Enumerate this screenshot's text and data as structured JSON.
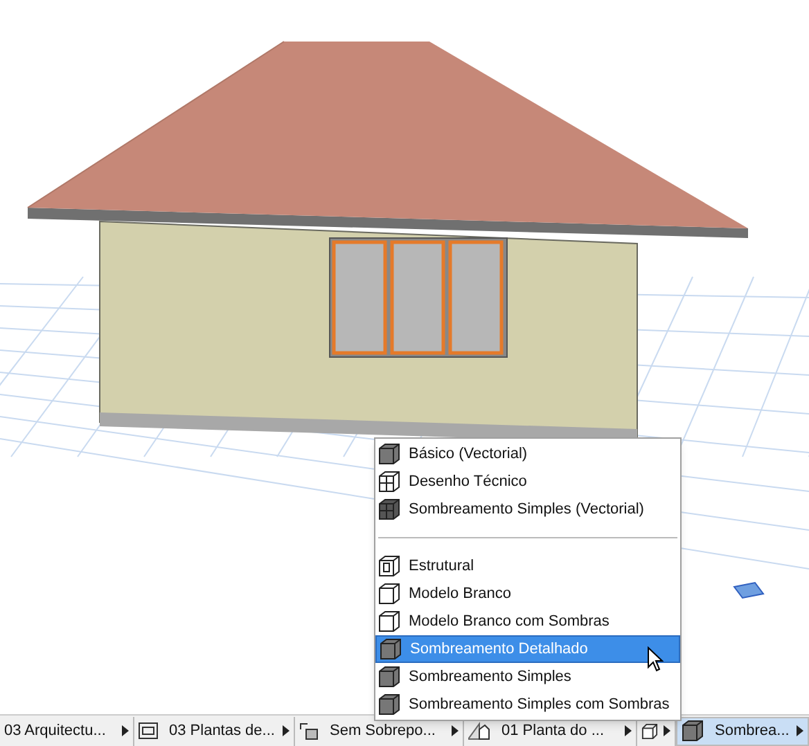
{
  "menu": {
    "groups": [
      [
        {
          "label": "Básico (Vectorial)",
          "selected": false
        },
        {
          "label": "Desenho Técnico",
          "selected": false
        },
        {
          "label": "Sombreamento Simples (Vectorial)",
          "selected": false
        }
      ],
      [
        {
          "label": "Estrutural",
          "selected": false
        },
        {
          "label": "Modelo Branco",
          "selected": false
        },
        {
          "label": "Modelo Branco com Sombras",
          "selected": false
        },
        {
          "label": "Sombreamento Detalhado",
          "selected": true
        },
        {
          "label": "Sombreamento Simples",
          "selected": false
        },
        {
          "label": "Sombreamento Simples com Sombras",
          "selected": false
        }
      ]
    ]
  },
  "status_bar": [
    {
      "label": "03 Arquitectu...",
      "selected": false
    },
    {
      "label": "03 Plantas de...",
      "selected": false
    },
    {
      "label": "Sem Sobrepo...",
      "selected": false
    },
    {
      "label": "01 Planta do ...",
      "selected": false
    },
    {
      "selected": false
    },
    {
      "label": "Sombrea...",
      "selected": true
    }
  ]
}
